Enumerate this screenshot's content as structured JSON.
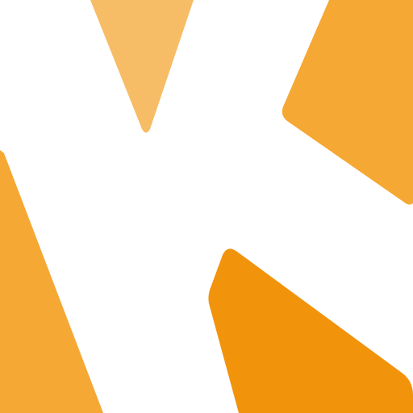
{
  "logo": {
    "colors": {
      "background": "#ffffff",
      "top_triangle": "#f7bd66",
      "upper_right_shape": "#f5a833",
      "left_shape": "#f5a833",
      "lower_right_shape": "#f2930c"
    }
  }
}
